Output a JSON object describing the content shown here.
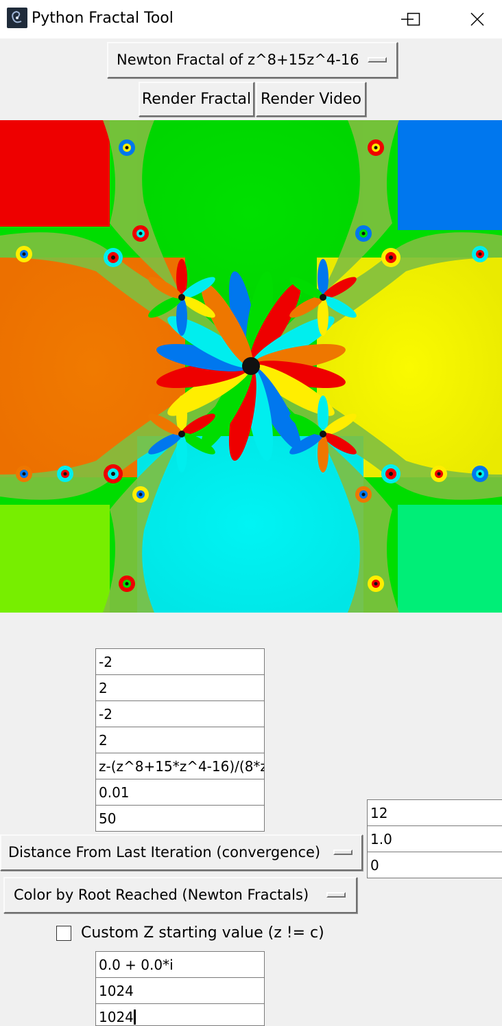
{
  "window": {
    "title": "Python Fractal Tool",
    "icon": "fractal-app-icon",
    "controls": [
      "minimize-icon",
      "maximize-icon",
      "close-icon"
    ]
  },
  "fractal_select": {
    "selected": "Newton Fractal of z^8+15z^4-16"
  },
  "buttons": {
    "render_fractal": "Render Fractal",
    "render_video": "Render Video"
  },
  "colors": {
    "root_red": "#ee0000",
    "root_green": "#00dd00",
    "root_blue": "#0077ee",
    "root_orange": "#ee7700",
    "root_yellow": "#eeee00",
    "root_cyan": "#00eeee",
    "root_lime": "#77ee00",
    "root_spring": "#00ee77",
    "julia_dark": "#111111"
  },
  "fields": {
    "xmin": "-2",
    "xmax": "2",
    "ymin": "-2",
    "ymax": "2",
    "formula": "z-(z^8+15*z^4-16)/(8*z",
    "tolerance": "0.01",
    "max_iterations": "50"
  },
  "right_fields": {
    "a": "12",
    "b": "1.0",
    "c": "0"
  },
  "selects": {
    "convergence_mode": "Distance From Last Iteration (convergence)",
    "color_mode": "Color by Root Reached (Newton Fractals)"
  },
  "custom_z": {
    "label": "Custom Z starting value (z != c)",
    "checked": false
  },
  "bottom_fields": {
    "z_start": "0.0 + 0.0*i",
    "width": "1024",
    "height": "1024"
  }
}
